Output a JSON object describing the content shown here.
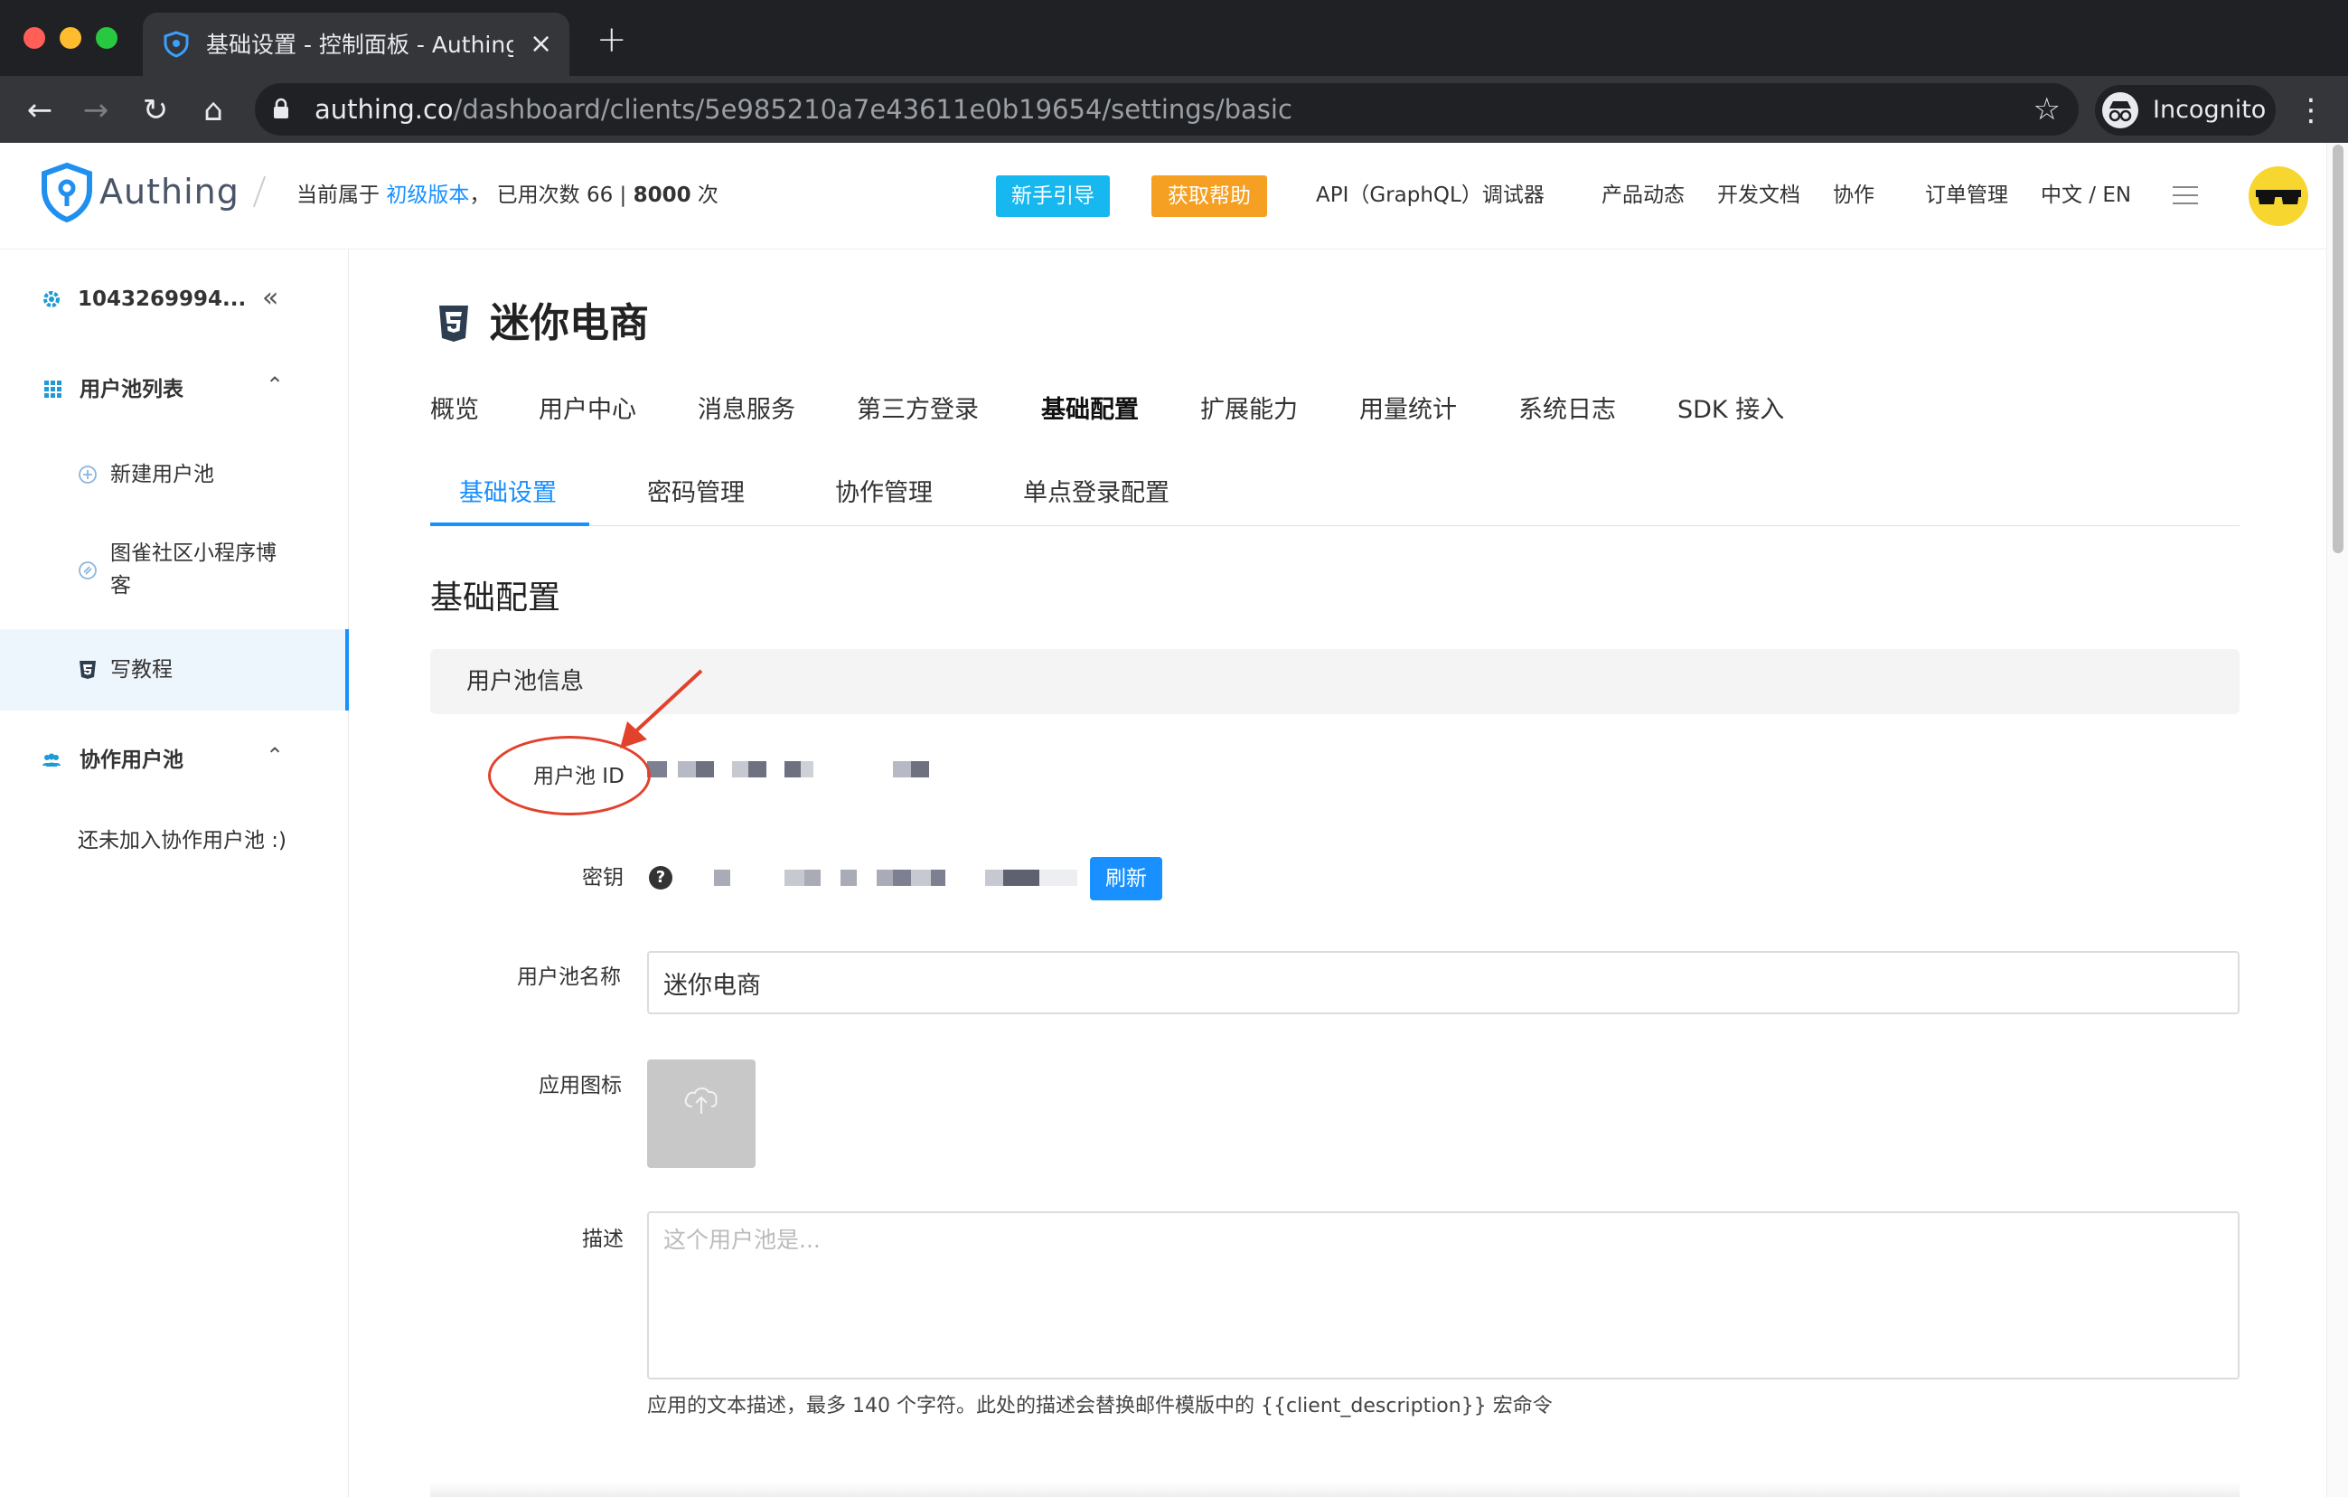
{
  "browser": {
    "tab_title": "基础设置 - 控制面板 - Authing 🌏",
    "url_host": "authing.co",
    "url_path": "/dashboard/clients/5e985210a7e43611e0b19654/settings/basic",
    "incognito_label": "Incognito"
  },
  "header": {
    "logo_text": "Authing",
    "plan_prefix": "当前属于",
    "plan_link": "初级版本",
    "plan_usage_prefix": "， 已用次数",
    "plan_used": "66",
    "plan_sep": "|",
    "plan_total": "8000",
    "plan_unit": "次",
    "btn_guide": "新手引导",
    "btn_help": "获取帮助",
    "nav": [
      {
        "label": "API（GraphQL）调试器"
      },
      {
        "label": "产品动态"
      },
      {
        "label": "开发文档"
      },
      {
        "label": "协作"
      },
      {
        "label": "订单管理"
      },
      {
        "label": "中文 / EN"
      }
    ],
    "colors": {
      "guide": "#17b7ef",
      "help": "#f5a022",
      "accent": "#1890ff"
    }
  },
  "sidebar": {
    "account": "1043269994...",
    "pool_list_title": "用户池列表",
    "new_pool": "新建用户池",
    "pools": [
      {
        "label": "图雀社区小程序博客"
      },
      {
        "label": "写教程"
      }
    ],
    "collab_title": "协作用户池",
    "collab_empty": "还未加入协作用户池 :)"
  },
  "main": {
    "title": "迷你电商",
    "tabs": [
      {
        "label": "概览"
      },
      {
        "label": "用户中心"
      },
      {
        "label": "消息服务"
      },
      {
        "label": "第三方登录"
      },
      {
        "label": "基础配置"
      },
      {
        "label": "扩展能力"
      },
      {
        "label": "用量统计"
      },
      {
        "label": "系统日志"
      },
      {
        "label": "SDK 接入"
      }
    ],
    "active_tab": "基础配置",
    "sub_tabs": [
      {
        "label": "基础设置"
      },
      {
        "label": "密码管理"
      },
      {
        "label": "协作管理"
      },
      {
        "label": "单点登录配置"
      }
    ],
    "active_sub_tab": "基础设置",
    "section_title": "基础配置",
    "group_title": "用户池信息",
    "fields": {
      "pool_id_label": "用户池 ID",
      "secret_label": "密钥",
      "refresh_button": "刷新",
      "pool_name_label": "用户池名称",
      "pool_name_value": "迷你电商",
      "icon_label": "应用图标",
      "desc_label": "描述",
      "desc_placeholder": "这个用户池是...",
      "desc_hint": "应用的文本描述，最多 140 个字符。此处的描述会替换邮件模版中的 {{client_description}} 宏命令"
    }
  },
  "icons": [
    "back-icon",
    "forward-icon",
    "reload-icon",
    "home-icon",
    "lock-icon",
    "star-icon",
    "incognito-icon",
    "kebab-icon",
    "authing-shield-icon",
    "menu-icon",
    "gear-icon",
    "grid-icon",
    "chevron-up-icon",
    "plus-circle-icon",
    "link-icon",
    "html5-icon",
    "team-icon",
    "help-icon",
    "upload-cloud-icon",
    "double-chevron-left-icon"
  ]
}
